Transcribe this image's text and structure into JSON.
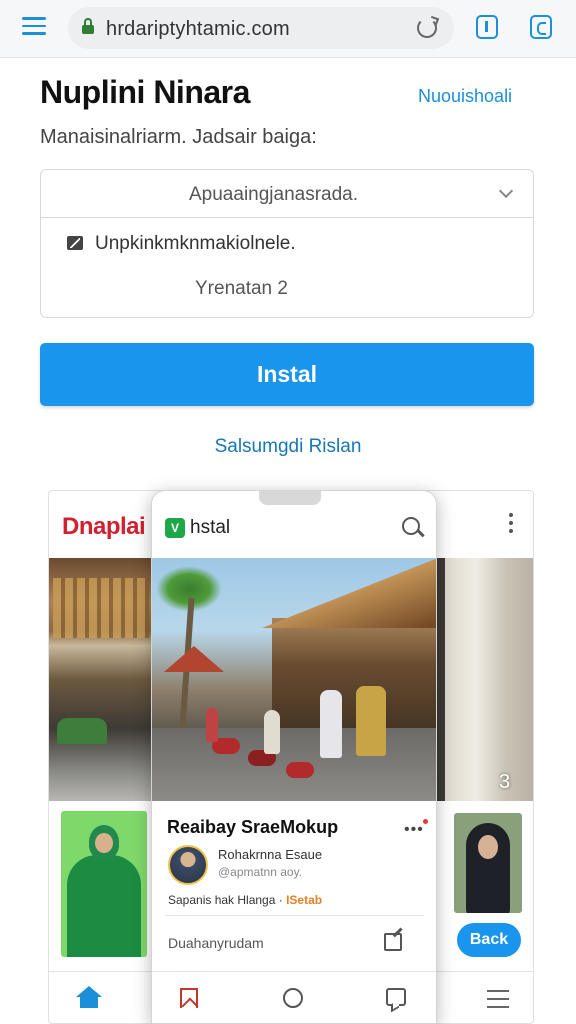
{
  "browser": {
    "url": "hrdariptyhtamic.com"
  },
  "header": {
    "title": "Nuplini Ninara",
    "link": "Nuouishoali",
    "subtitle": "Manaisinalriarm. Jadsair baiga:"
  },
  "form": {
    "select_value": "Apuaaingjanasrada.",
    "checkbox_label": "Unpkinkmknmakiolnele.",
    "version_value": "Yrenatan 2"
  },
  "install_button": {
    "label": "Instal"
  },
  "alt_link": "Salsumgdi Rislan",
  "preview": {
    "brand": "Dnaplai",
    "photo_count": "3",
    "back_button": "Back",
    "app_name": "hstal",
    "app_logo": "V",
    "profile_title": "Reaibay SraeMokup",
    "profile_name": "Rohakrnna Esaue",
    "profile_handle": "@apmatnn aoy.",
    "promo_text": "Sapanis hak Hlanga ·",
    "promo_highlight": "ISetab",
    "comment_text": "Duahanyrudam"
  },
  "colors": {
    "accent": "#1a95ee",
    "link": "#1c8fd9",
    "brand_red": "#d1202f",
    "secure_green": "#2e7d32"
  },
  "icons": [
    "menu-icon",
    "lock-icon",
    "reload-icon",
    "tab-icon",
    "chevron-down-icon",
    "checkbox-icon",
    "kebab-icon",
    "search-icon",
    "home-icon",
    "bookmark-icon",
    "circle-icon",
    "chat-icon",
    "edit-icon"
  ]
}
